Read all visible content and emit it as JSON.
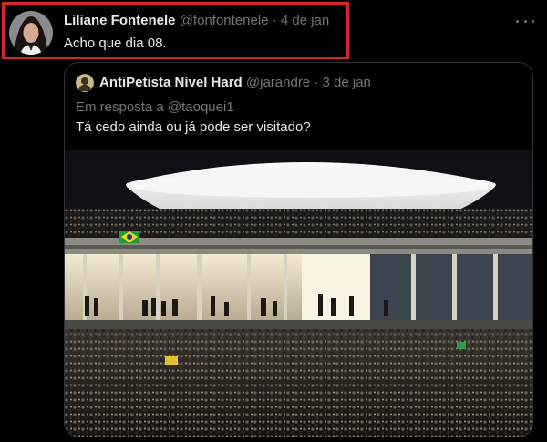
{
  "tweet": {
    "author_name": "Liliane Fontenele",
    "handle": "@fonfontenele",
    "separator": "·",
    "date": "4 de jan",
    "text": "Acho que dia 08."
  },
  "quoted_tweet": {
    "author_name": "AntiPetista Nível Hard",
    "handle": "@jarandre",
    "separator": "·",
    "date": "3 de jan",
    "reply_prefix": "Em resposta a ",
    "reply_to": "@taoquei1",
    "text": "Tá cedo ainda ou já pode ser visitado?"
  },
  "icons": {
    "more": "more-options-icon"
  },
  "colors": {
    "background": "#000000",
    "text_primary": "#e7e9ea",
    "text_secondary": "#71767b",
    "highlight_border": "#d9262c",
    "quote_border": "#2f3336"
  }
}
